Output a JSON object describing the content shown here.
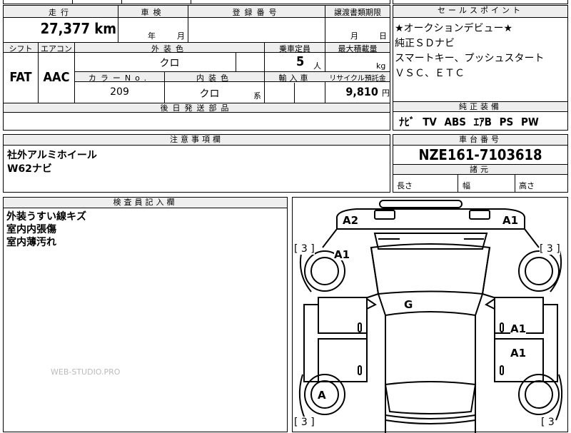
{
  "top_cut": {
    "left": "",
    "mid": "",
    "right": ""
  },
  "main_table": {
    "mileage_label": "走行",
    "mileage_value": "27,377",
    "mileage_unit": "km",
    "inspection_label": "車検",
    "inspection_year_unit": "年",
    "inspection_month_unit": "月",
    "registration_label": "登録番号",
    "transfer_label": "譲渡書類期限",
    "transfer_month_unit": "月",
    "transfer_day_unit": "日",
    "shift_label": "シフト",
    "ac_label": "エアコン",
    "exterior_color_label": "外装色",
    "capacity_label": "乗車定員",
    "max_load_label": "最大積載量",
    "shift_value": "FAT",
    "ac_value": "AAC",
    "exterior_color_value": "クロ",
    "capacity_value": "5",
    "capacity_unit": "人",
    "max_load_unit": "kg",
    "color_no_label": "カラーNo.",
    "interior_color_label": "内装色",
    "import_label": "輸入車",
    "recycle_label": "リサイクル預託金",
    "color_no_value": "209",
    "interior_color_value": "クロ",
    "interior_color_suffix": "系",
    "recycle_value": "9,810",
    "recycle_unit": "円",
    "later_parts_label": "後日発送部品"
  },
  "sales_points": {
    "label": "セールスポイント",
    "lines": [
      "★オークションデビュー★",
      "純正ＳＤナビ",
      "スマートキー、プッシュスタート",
      "ＶＳＣ、ＥＴＣ"
    ]
  },
  "equipment": {
    "label": "純正装備",
    "value": "ﾅﾋﾞ TV ABS ｴｱB PS PW"
  },
  "notes": {
    "label": "注意事項欄",
    "lines": [
      "社外アルミホイール",
      "W62ナビ"
    ]
  },
  "chassis": {
    "label": "車台番号",
    "value": "NZE161-7103618"
  },
  "dimensions": {
    "label": "諸元",
    "length_label": "長さ",
    "width_label": "幅",
    "height_label": "高さ"
  },
  "inspector": {
    "label": "検査員記入欄",
    "lines": [
      "外装うすい線キズ",
      "室内内張傷",
      "室内薄汚れ"
    ]
  },
  "watermark": "WEB-STUDIO.PRO",
  "diagram": {
    "marks": {
      "a2_front_left": "A2",
      "a1_front_right": "A1",
      "a1_fender_left": "A1",
      "g_windshield": "G",
      "a1_door_front_right": "A1",
      "a1_door_rear_right": "A1",
      "a_rear_left_wheel": "A",
      "tire_front_left": "[ 3 ]",
      "tire_front_right": "[ 3 ]",
      "tire_rear_left": "[ 3 ]",
      "tire_rear_right": "[ 3"
    }
  }
}
